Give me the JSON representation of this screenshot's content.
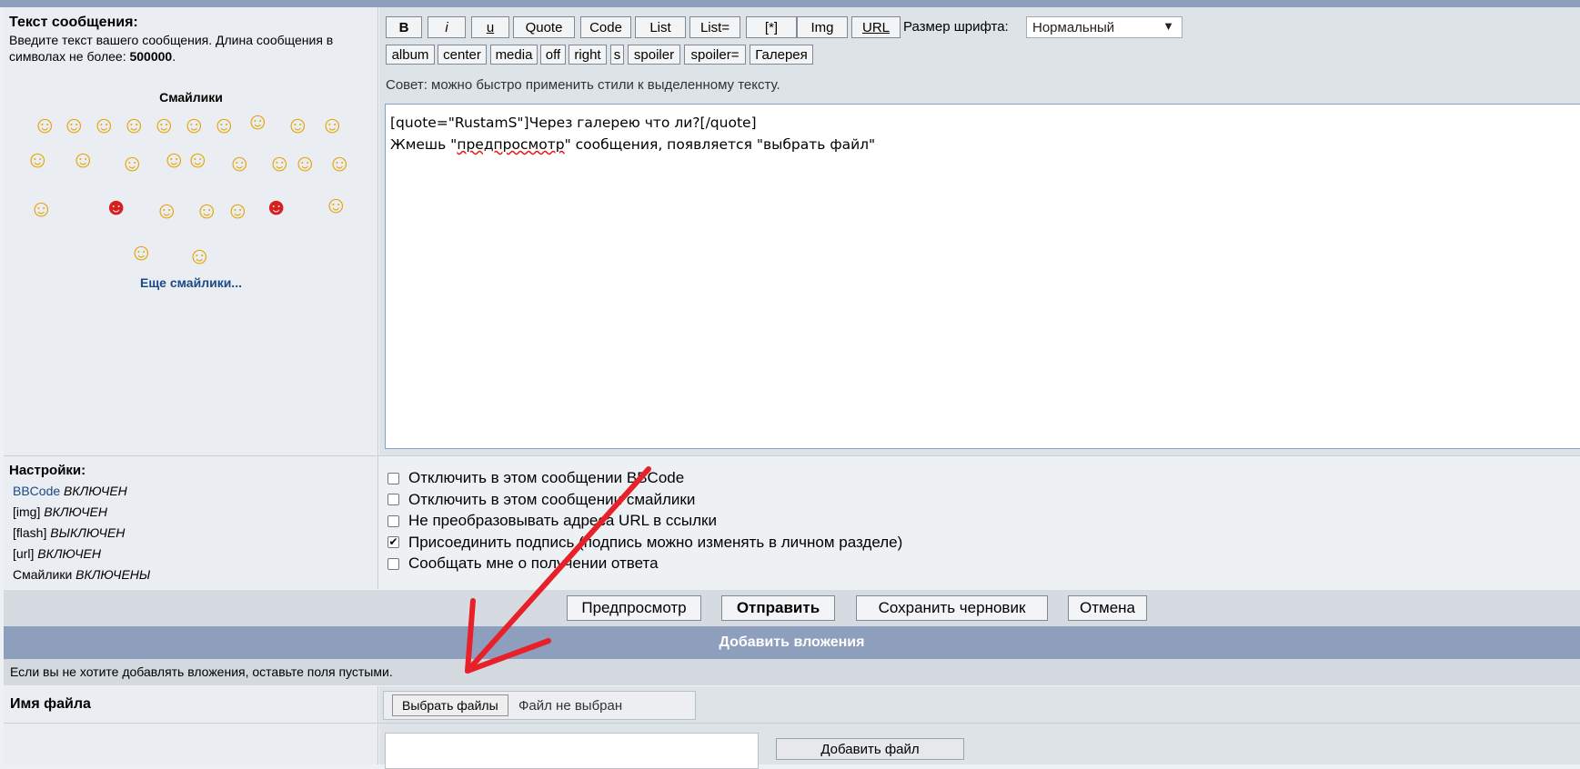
{
  "message": {
    "title": "Текст сообщения:",
    "desc_prefix": "Введите текст вашего сообщения. Длина сообщения в символах не более: ",
    "max_length": "500000",
    "desc_suffix": "."
  },
  "smilies": {
    "title": "Смайлики",
    "icons": [
      "grin-icon",
      "smile-icon",
      "unsure-icon",
      "facepalm-icon",
      "sad-icon",
      "happy-icon",
      "blush-icon",
      "kiss-icon",
      "point-icon",
      "neutral-icon",
      "frown-icon",
      "dance-icon",
      "crazy-icon",
      "drinks-icon",
      "smile2-icon",
      "shock-icon",
      "cool-icon",
      "thumb-icon",
      "wave-icon",
      "hello-icon",
      "angry-icon",
      "tongue-icon",
      "bruise-icon",
      "question-icon",
      "devil-icon",
      "hands-icon",
      "scream-icon",
      "wink-icon"
    ],
    "more_link": "Еще смайлики..."
  },
  "toolbar": {
    "row1": [
      "B",
      "i",
      "u",
      "Quote",
      "Code",
      "List",
      "List=",
      "[*]",
      "Img",
      "URL"
    ],
    "row2": [
      "album",
      "center",
      "media",
      "off",
      "right",
      "s",
      "spoiler",
      "spoiler=",
      "Галерея"
    ],
    "font_size_label": "Размер шрифта:",
    "font_size_value": "Нормальный",
    "hint": "Совет: можно быстро применить стили к выделенному тексту."
  },
  "editor": {
    "line1": "[quote=\"RustamS\"]Через галерею что ли?[/quote]",
    "line2_before": "Жмешь \"",
    "line2_misspelled": "предпросмотр",
    "line2_after": "\" сообщения, появляется \"выбрать файл\""
  },
  "settings": {
    "title": "Настройки:",
    "bbcode_link": "BBCode",
    "bbcode_state": "ВКЛЮЧЕН",
    "img_label": "[img]",
    "img_state": "ВКЛЮЧЕН",
    "flash_label": "[flash]",
    "flash_state": "ВЫКЛЮЧЕН",
    "url_label": "[url]",
    "url_state": "ВКЛЮЧЕН",
    "smilies_label": "Смайлики",
    "smilies_state": "ВКЛЮЧЕНЫ"
  },
  "options": [
    {
      "label": "Отключить в этом сообщении BBCode",
      "checked": false
    },
    {
      "label": "Отключить в этом сообщении смайлики",
      "checked": false
    },
    {
      "label": "Не преобразовывать адреса URL в ссылки",
      "checked": false
    },
    {
      "label": "Присоединить подпись (подпись можно изменять в личном разделе)",
      "checked": true
    },
    {
      "label": "Сообщать мне о получении ответа",
      "checked": false
    }
  ],
  "actions": {
    "preview": "Предпросмотр",
    "submit": "Отправить",
    "save_draft": "Сохранить черновик",
    "cancel": "Отмена"
  },
  "attachments": {
    "header": "Добавить вложения",
    "note": "Если вы не хотите добавлять вложения, оставьте поля пустыми.",
    "file_label": "Имя файла",
    "choose_button": "Выбрать файлы",
    "no_file": "Файл не выбран",
    "add_button": "Добавить файл"
  },
  "colors": {
    "accent_header": "#8d9fbc",
    "annotation_arrow": "#e8202a",
    "link": "#1c4a84"
  }
}
